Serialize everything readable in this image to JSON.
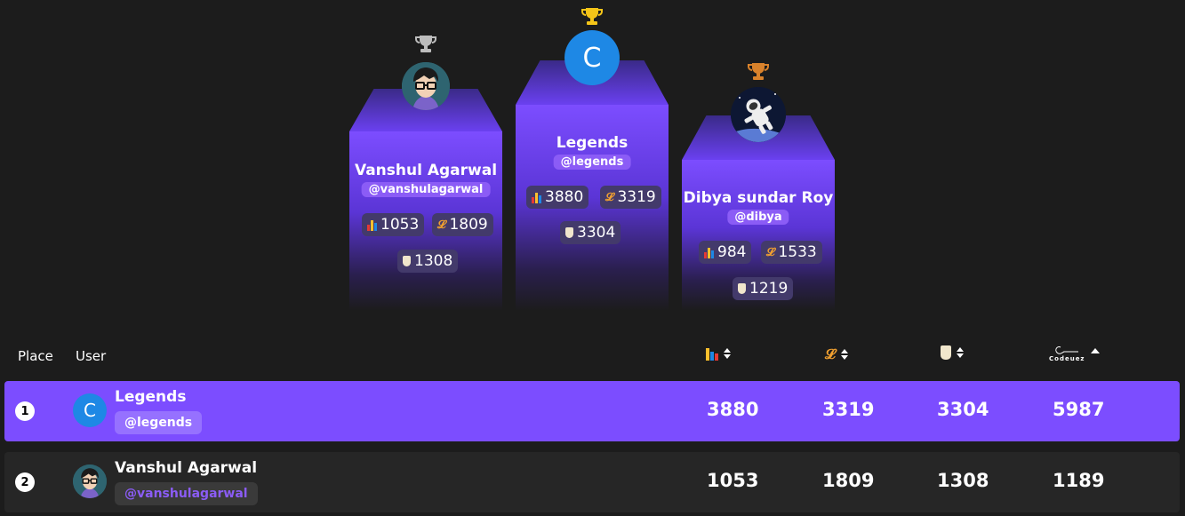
{
  "podium": {
    "first": {
      "avatar_letter": "C",
      "name": "Legends",
      "handle": "@legends",
      "codechef": "3880",
      "leetcode": "3319",
      "codeforces": "3304",
      "trophy_color": "#f5c518"
    },
    "second": {
      "name": "Vanshul Agarwal",
      "handle": "@vanshulagarwal",
      "codechef": "1053",
      "leetcode": "1809",
      "codeforces": "1308",
      "trophy_color": "#bdbdbd"
    },
    "third": {
      "name": "Dibya sundar Roy",
      "handle": "@dibya",
      "codechef": "984",
      "leetcode": "1533",
      "codeforces": "1219",
      "trophy_color": "#d9822b"
    }
  },
  "table": {
    "headers": {
      "place": "Place",
      "user": "User",
      "codechef_icon": "codechef-icon",
      "leetcode_icon": "leetcode-icon",
      "codeforces_icon": "codeforces-icon",
      "codeuez_logo": "Codeuez"
    },
    "rows": [
      {
        "rank": "1",
        "avatar_letter": "C",
        "name": "Legends",
        "handle": "@legends",
        "codechef": "3880",
        "leetcode": "3319",
        "codeforces": "3304",
        "total": "5987"
      },
      {
        "rank": "2",
        "name": "Vanshul Agarwal",
        "handle": "@vanshulagarwal",
        "codechef": "1053",
        "leetcode": "1809",
        "codeforces": "1308",
        "total": "1189"
      }
    ]
  },
  "colors": {
    "accent": "#7c4dff",
    "background": "#1c1c1c",
    "row_dark": "#262626",
    "avatar_blue": "#1e88e5"
  }
}
